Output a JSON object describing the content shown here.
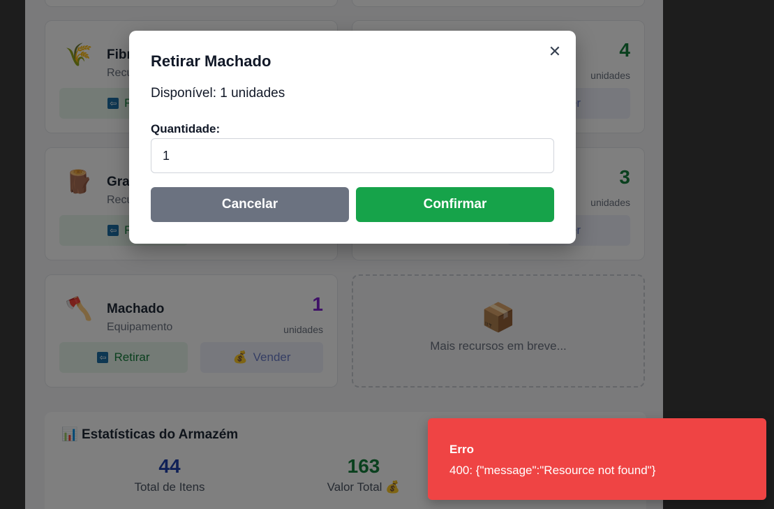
{
  "cards": [
    {
      "name": "Fibr",
      "category": "Recu",
      "icon": "🌾",
      "qty": "",
      "unit": "",
      "retirar": "Re",
      "vender": ""
    },
    {
      "name": "",
      "category": "",
      "icon": "",
      "qty": "4",
      "unit": "unidades",
      "retirar": "",
      "vender": "nder"
    },
    {
      "name": "Gra",
      "category": "Recu",
      "icon": "🪵",
      "qty": "",
      "unit": "",
      "retirar": "Re",
      "vender": ""
    },
    {
      "name": "",
      "category": "",
      "icon": "",
      "qty": "3",
      "unit": "unidades",
      "retirar": "",
      "vender": "nder"
    },
    {
      "name": "Machado",
      "category": "Equipamento",
      "icon": "🪓",
      "qty": "1",
      "unit": "unidades",
      "retirar": "Retirar",
      "vender": "Vender"
    }
  ],
  "placeholder": {
    "icon": "📦",
    "text": "Mais recursos em breve..."
  },
  "stats": {
    "title": "Estatísticas do Armazém",
    "icon": "📊",
    "items": [
      {
        "value": "44",
        "label": "Total de Itens",
        "color": "#1e40af"
      },
      {
        "value": "163",
        "label": "Valor Total 💰",
        "color": "#15803d"
      }
    ]
  },
  "modal": {
    "title": "Retirar Machado",
    "available": "Disponível: 1 unidades",
    "quantity_label": "Quantidade:",
    "quantity_value": "1",
    "cancel_label": "Cancelar",
    "confirm_label": "Confirmar"
  },
  "toast": {
    "title": "Erro",
    "message": "400: {\"message\":\"Resource not found\"}"
  }
}
